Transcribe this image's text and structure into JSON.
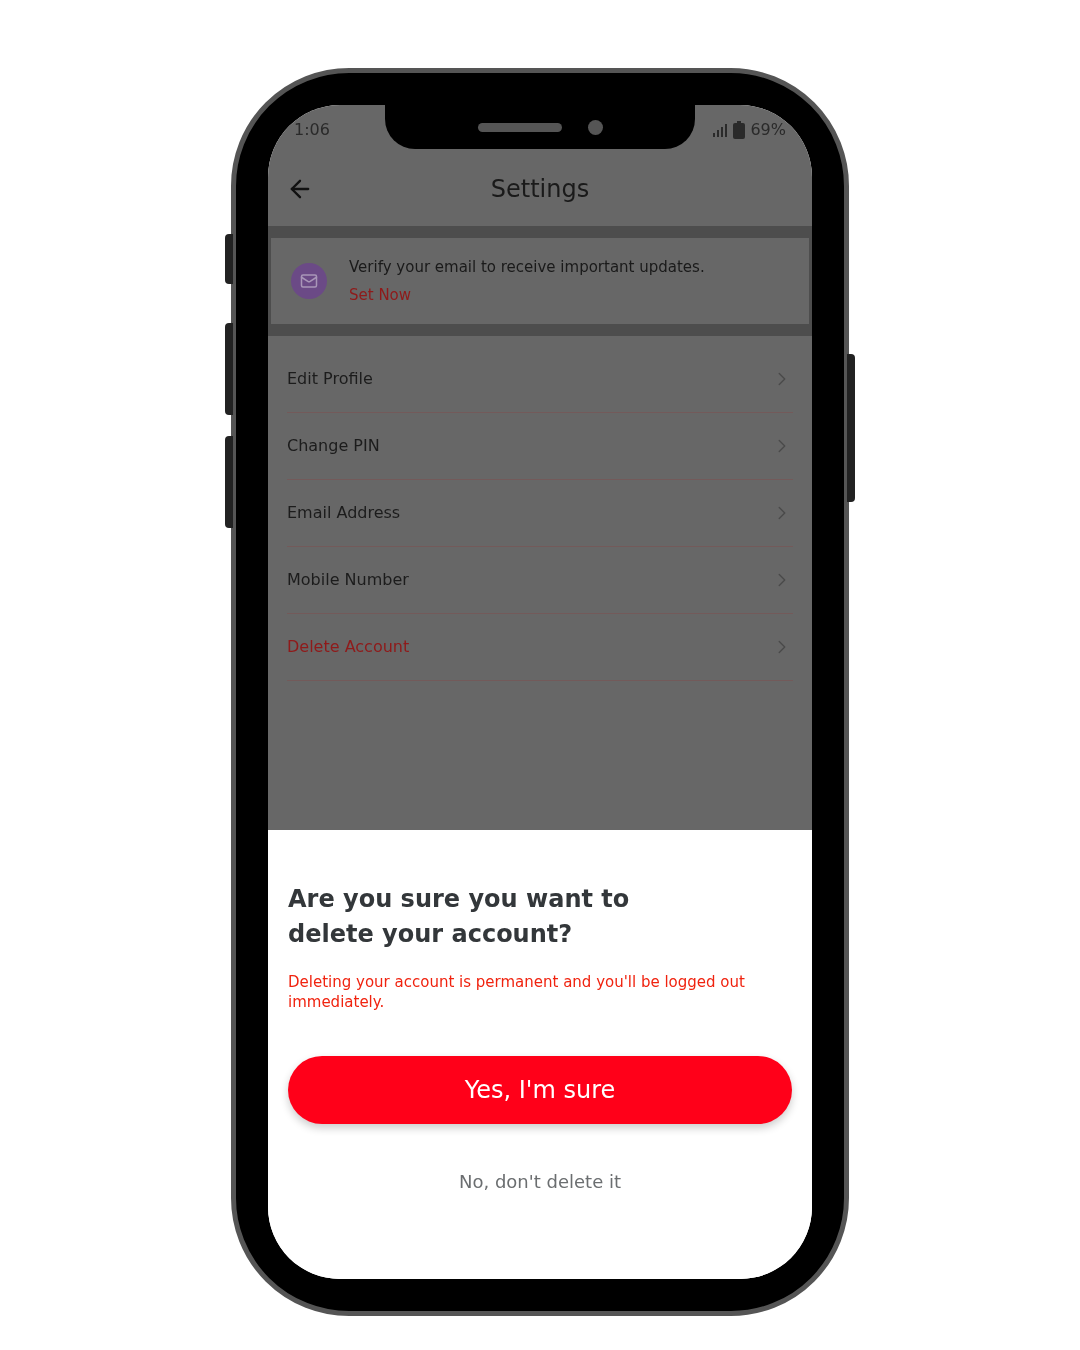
{
  "status_bar": {
    "time": "1:06",
    "battery": "69%"
  },
  "header": {
    "title": "Settings"
  },
  "banner": {
    "message": "Verify your email to receive important updates.",
    "action": "Set Now"
  },
  "menu": [
    {
      "label": "Edit Profile",
      "kind": "normal"
    },
    {
      "label": "Change PIN",
      "kind": "normal"
    },
    {
      "label": "Email Address",
      "kind": "normal"
    },
    {
      "label": "Mobile Number",
      "kind": "normal"
    },
    {
      "label": "Delete Account",
      "kind": "danger"
    }
  ],
  "dialog": {
    "title": "Are you sure you want to delete your account?",
    "warning": "Deleting your account is permanent and you'll be logged out immediately.",
    "confirm": "Yes, I'm sure",
    "cancel": "No, don't delete it"
  }
}
